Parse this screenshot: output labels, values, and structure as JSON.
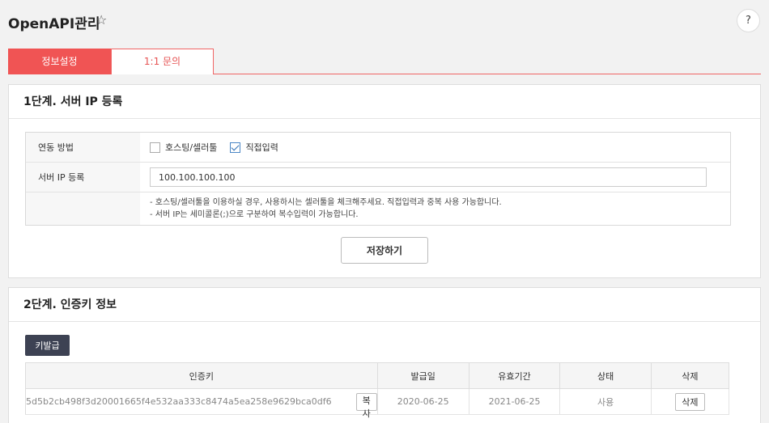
{
  "header": {
    "title": "OpenAPI관리",
    "star_icon": "star-outline-icon",
    "help_label": "?"
  },
  "tabs": [
    {
      "label": "정보설정",
      "active": true
    },
    {
      "label": "1:1 문의",
      "active": false
    }
  ],
  "step1": {
    "title": "1단계. 서버 IP 등록",
    "link_method_label": "연동 방법",
    "options": [
      {
        "label": "호스팅/셀러툴",
        "checked": false
      },
      {
        "label": "직접입력",
        "checked": true
      }
    ],
    "server_ip_label": "서버 IP 등록",
    "server_ip_value": "100.100.100.100",
    "notes": [
      "- 호스팅/셀러툴을 이용하실 경우, 사용하시는 셀러툴을 체크해주세요. 직접입력과 중복 사용 가능합니다.",
      "- 서버 IP는 세미콜론(;)으로 구분하여 복수입력이 가능합니다."
    ],
    "save_label": "저장하기"
  },
  "step2": {
    "title": "2단계. 인증키 정보",
    "issue_label": "키발급",
    "columns": [
      "인증키",
      "발급일",
      "유효기간",
      "상태",
      "삭제"
    ],
    "rows": [
      {
        "key": "5d5b2cb498f3d20001665f4e532aa333c8474a5ea258e9629bca0df6",
        "copy_label": "복사",
        "issued": "2020-06-25",
        "expires": "2021-06-25",
        "status": "사용",
        "delete_label": "삭제"
      }
    ]
  }
}
